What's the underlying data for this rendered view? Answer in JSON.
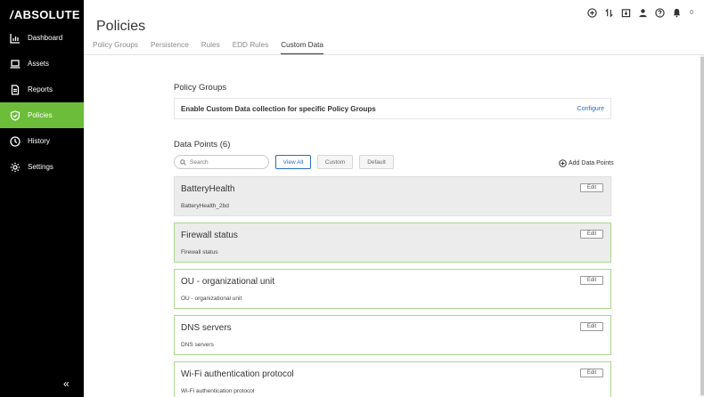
{
  "brand": {
    "logo_text": "ABSOLUTE"
  },
  "sidebar": {
    "items": [
      {
        "label": "Dashboard",
        "icon": "chart-icon"
      },
      {
        "label": "Assets",
        "icon": "laptop-icon"
      },
      {
        "label": "Reports",
        "icon": "document-icon"
      },
      {
        "label": "Policies",
        "icon": "shield-icon",
        "active": true
      },
      {
        "label": "History",
        "icon": "clock-icon"
      },
      {
        "label": "Settings",
        "icon": "gear-icon"
      }
    ],
    "collapse_label": "«"
  },
  "header": {
    "title": "Policies",
    "notification_count": "0",
    "icons": [
      "plus-circle-icon",
      "transfer-icon",
      "download-icon",
      "user-icon",
      "help-icon",
      "bell-icon"
    ]
  },
  "tabs": [
    {
      "label": "Policy Groups"
    },
    {
      "label": "Persistence"
    },
    {
      "label": "Rules"
    },
    {
      "label": "EDD Rules"
    },
    {
      "label": "Custom Data",
      "active": true
    }
  ],
  "policy_groups": {
    "title": "Policy Groups",
    "row_label": "Enable Custom Data collection for specific Policy Groups",
    "configure_label": "Configure"
  },
  "data_points": {
    "title": "Data Points (6)",
    "search_placeholder": "Search",
    "search_value": "",
    "filters": [
      "View All",
      "Custom",
      "Default"
    ],
    "active_filter": "View All",
    "add_label": "Add Data Points",
    "edit_label": "Edit",
    "items": [
      {
        "name": "BatteryHealth",
        "description": "BatteryHealth_2bd"
      },
      {
        "name": "Firewall status",
        "description": "Firewall status"
      },
      {
        "name": "OU - organizational unit",
        "description": "OU - organizational unit"
      },
      {
        "name": "DNS servers",
        "description": "DNS servers"
      },
      {
        "name": "Wi-Fi authentication protocol",
        "description": "Wi-Fi authentication protocol"
      }
    ]
  },
  "colors": {
    "accent": "#6cbd3a",
    "link": "#2a6ebb",
    "sidebar_bg": "#000000"
  }
}
